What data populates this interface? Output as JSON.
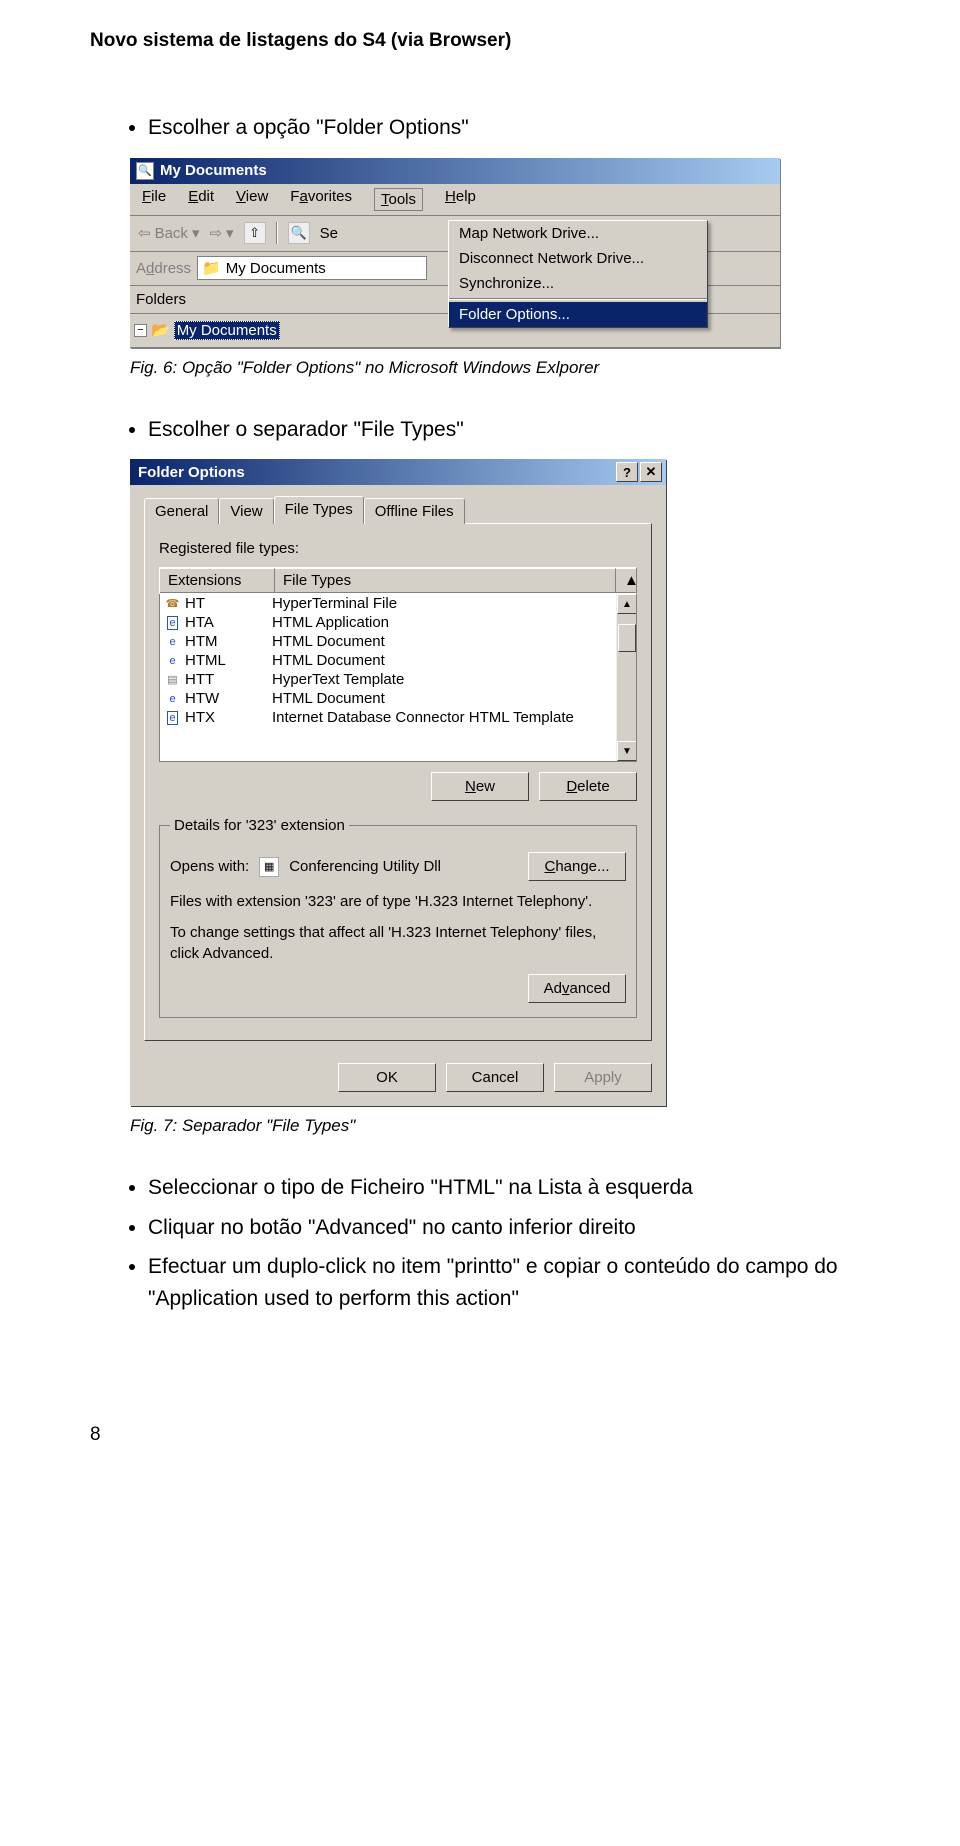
{
  "doc": {
    "header": "Novo sistema de listagens do S4 (via Browser)",
    "bullet1": "Escolher a opção \"Folder Options\"",
    "caption1": "Fig. 6:  Opção \"Folder Options\" no Microsoft Windows Exlporer",
    "bullet2": "Escolher o separador \"File Types\"",
    "caption2": "Fig. 7: Separador \"File Types\"",
    "bullet3": "Seleccionar o tipo de Ficheiro \"HTML\" na Lista à esquerda",
    "bullet4": "Cliquar no botão \"Advanced\" no canto inferior direito",
    "bullet5": "Efectuar um duplo-click no item \"printto\" e copiar o conteúdo do campo do \"Application used to perform this action\"",
    "pagenum": "8"
  },
  "explorer": {
    "title": "My Documents",
    "menus": {
      "file": "File",
      "edit": "Edit",
      "view": "View",
      "favorites": "Favorites",
      "tools": "Tools",
      "help": "Help"
    },
    "toolbar": {
      "back": "Back",
      "search_abbr": "Se"
    },
    "addressbar": {
      "label": "Address",
      "value": "My Documents"
    },
    "folders_label": "Folders",
    "tree_item": "My Documents",
    "tools_menu": {
      "map": "Map Network Drive...",
      "disconnect": "Disconnect Network Drive...",
      "sync": "Synchronize...",
      "folder_options": "Folder Options..."
    }
  },
  "dialog": {
    "title": "Folder Options",
    "titlebar_help": "?",
    "titlebar_close": "✕",
    "tabs": {
      "general": "General",
      "view": "View",
      "filetypes": "File Types",
      "offline": "Offline Files"
    },
    "group_label": "Registered file types:",
    "cols": {
      "ext": "Extensions",
      "ft": "File Types"
    },
    "rows": [
      {
        "ext": "HT",
        "type": "HyperTerminal File",
        "icon": "ht"
      },
      {
        "ext": "HTA",
        "type": "HTML Application",
        "icon": "ie-sq"
      },
      {
        "ext": "HTM",
        "type": "HTML Document",
        "icon": "ie"
      },
      {
        "ext": "HTML",
        "type": "HTML Document",
        "icon": "ie"
      },
      {
        "ext": "HTT",
        "type": "HyperText Template",
        "icon": "doc"
      },
      {
        "ext": "HTW",
        "type": "HTML Document",
        "icon": "ie"
      },
      {
        "ext": "HTX",
        "type": "Internet Database Connector HTML Template",
        "icon": "ie-sq"
      }
    ],
    "buttons": {
      "new": "New",
      "delete": "Delete",
      "change": "Change...",
      "advanced": "Advanced",
      "ok": "OK",
      "cancel": "Cancel",
      "apply": "Apply"
    },
    "details": {
      "legend": "Details for '323' extension",
      "opens_with_label": "Opens with:",
      "opens_with_value": "Conferencing Utility Dll",
      "line1": "Files with extension '323' are of type 'H.323 Internet Telephony'.",
      "line2": "To change settings that affect all 'H.323 Internet Telephony' files, click Advanced."
    }
  }
}
